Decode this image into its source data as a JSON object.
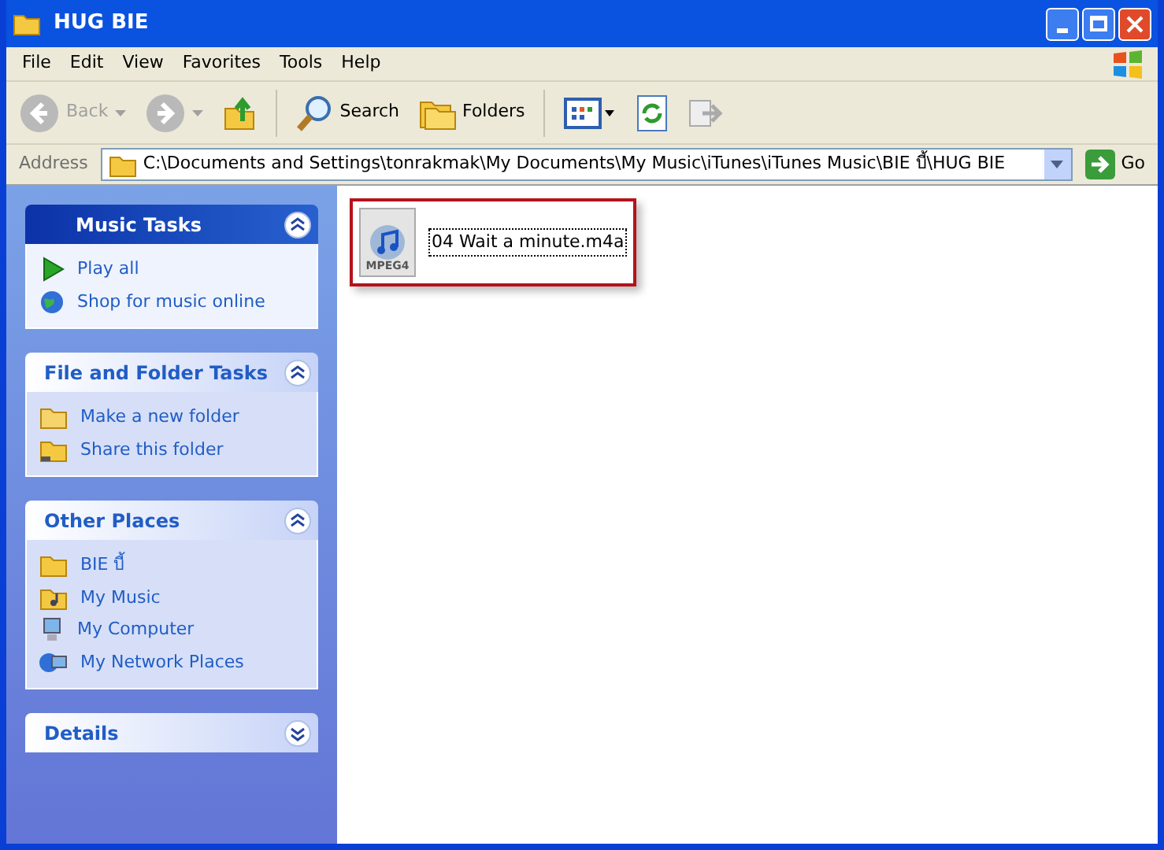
{
  "window": {
    "title": "HUG BIE"
  },
  "menu": [
    "File",
    "Edit",
    "View",
    "Favorites",
    "Tools",
    "Help"
  ],
  "toolbar": [
    {
      "kind": "back",
      "label": "Back",
      "disabled": true
    },
    {
      "kind": "forward",
      "disabled": true
    },
    {
      "kind": "up"
    },
    {
      "kind": "search",
      "label": "Search"
    },
    {
      "kind": "folders",
      "label": "Folders"
    },
    {
      "kind": "views"
    },
    {
      "kind": "sync"
    },
    {
      "kind": "move",
      "disabled": true
    }
  ],
  "address": {
    "label": "Address",
    "value": "C:\\Documents and Settings\\tonrakmak\\My Documents\\My Music\\iTunes\\iTunes Music\\BIE บี้\\HUG BIE",
    "go": "Go"
  },
  "panels": [
    {
      "title": "Music Tasks",
      "kind": "special",
      "expanded": true,
      "items": [
        {
          "kind": "play",
          "label": "Play all"
        },
        {
          "kind": "globe",
          "label": "Shop for music online"
        }
      ]
    },
    {
      "title": "File and Folder Tasks",
      "kind": "normal",
      "expanded": true,
      "items": [
        {
          "kind": "newfolder",
          "label": "Make a new folder"
        },
        {
          "kind": "share",
          "label": "Share this folder"
        }
      ]
    },
    {
      "title": "Other Places",
      "kind": "normal",
      "expanded": true,
      "items": [
        {
          "kind": "folder",
          "label": "BIE บี้"
        },
        {
          "kind": "music",
          "label": "My Music"
        },
        {
          "kind": "computer",
          "label": "My Computer"
        },
        {
          "kind": "network",
          "label": "My Network Places"
        }
      ]
    },
    {
      "title": "Details",
      "kind": "normal",
      "expanded": false
    }
  ],
  "files": [
    {
      "name": "04 Wait a minute.m4a",
      "icon_label": "MPEG4",
      "selected": true,
      "highlighted": true
    }
  ]
}
